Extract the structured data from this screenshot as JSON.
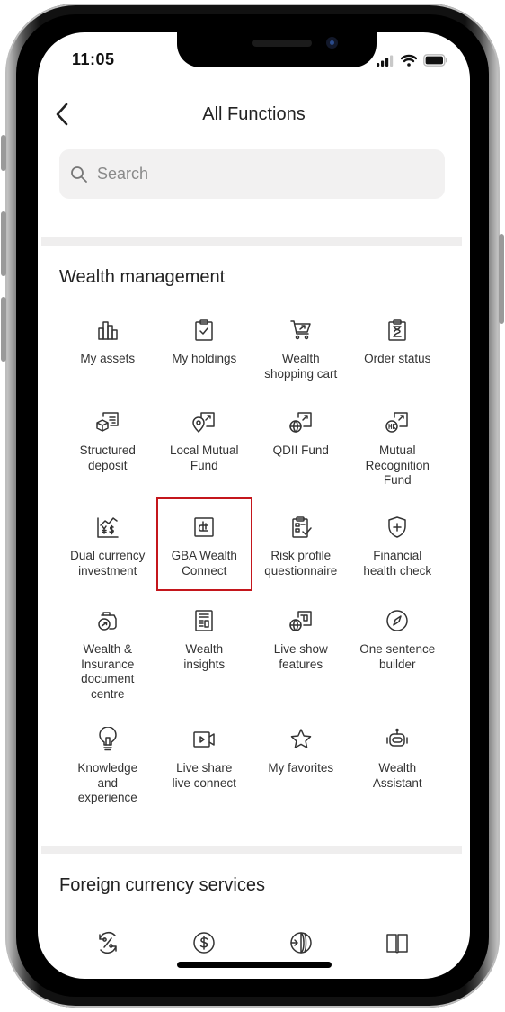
{
  "status_bar": {
    "time": "11:05",
    "icons": [
      "cellular-signal-icon",
      "wifi-icon",
      "battery-icon"
    ]
  },
  "header": {
    "back_icon": "chevron-left-icon",
    "title": "All Functions"
  },
  "search": {
    "icon": "search-icon",
    "placeholder": "Search",
    "value": ""
  },
  "sections": [
    {
      "title": "Wealth management",
      "items": [
        {
          "label": "My assets",
          "icon": "bar-chart-icon"
        },
        {
          "label": "My holdings",
          "icon": "clipboard-check-icon"
        },
        {
          "label": "Wealth\nshopping cart",
          "icon": "shopping-cart-icon"
        },
        {
          "label": "Order status",
          "icon": "clipboard-hourglass-icon"
        },
        {
          "label": "Structured\ndeposit",
          "icon": "structured-deposit-icon"
        },
        {
          "label": "Local Mutual\nFund",
          "icon": "location-fund-icon"
        },
        {
          "label": "QDII Fund",
          "icon": "globe-fund-icon"
        },
        {
          "label": "Mutual\nRecognition\nFund",
          "icon": "hk-fund-icon"
        },
        {
          "label": "Dual currency\ninvestment",
          "icon": "yen-dollar-chart-icon"
        },
        {
          "label": "GBA Wealth\nConnect",
          "icon": "gba-connect-icon",
          "highlighted": true
        },
        {
          "label": "Risk profile\nquestionnaire",
          "icon": "questionnaire-icon"
        },
        {
          "label": "Financial\nhealth check",
          "icon": "shield-plus-icon"
        },
        {
          "label": "Wealth &\nInsurance\ndocument\ncentre",
          "icon": "document-centre-icon"
        },
        {
          "label": "Wealth\ninsights",
          "icon": "newspaper-icon"
        },
        {
          "label": "Live show\nfeatures",
          "icon": "globe-screen-icon"
        },
        {
          "label": "One sentence\nbuilder",
          "icon": "compass-icon"
        },
        {
          "label": "Knowledge\nand\nexperience",
          "icon": "lightbulb-icon"
        },
        {
          "label": "Live share\nlive connect",
          "icon": "video-camera-icon"
        },
        {
          "label": "My favorites",
          "icon": "star-icon"
        },
        {
          "label": "Wealth\nAssistant",
          "icon": "robot-icon"
        }
      ]
    },
    {
      "title": "Foreign currency services",
      "items": [
        {
          "icon": "percent-exchange-icon"
        },
        {
          "icon": "dollar-circle-icon"
        },
        {
          "icon": "globe-transfer-icon"
        },
        {
          "icon": "book-icon"
        }
      ]
    }
  ],
  "highlight_color": "#c4161c"
}
